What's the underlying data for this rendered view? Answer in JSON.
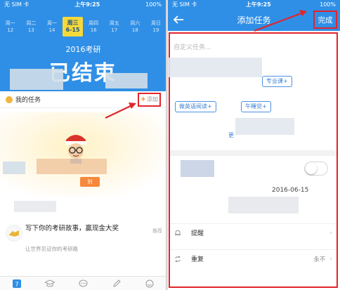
{
  "left": {
    "status": {
      "carrier": "无 SIM 卡",
      "time": "上午9:25",
      "battery": "100%"
    },
    "calendar": {
      "days": [
        {
          "label": "周一",
          "date": "12"
        },
        {
          "label": "周二",
          "date": "13"
        },
        {
          "label": "周一",
          "date": "14"
        },
        {
          "label": "周三",
          "date": "6-15",
          "selected": true
        },
        {
          "label": "周四",
          "date": "16"
        },
        {
          "label": "周五",
          "date": "17"
        },
        {
          "label": "周六",
          "date": "18"
        },
        {
          "label": "周日",
          "date": "19"
        }
      ],
      "year_title": "2016考研",
      "status_big": "已结束"
    },
    "tasks": {
      "title": "我的任务",
      "add_label": "添加"
    },
    "promo_tag": "别",
    "story": {
      "title": "写下你的考研故事，赢现金大奖",
      "subtitle": "让世界见证你的考研路",
      "more": "推荐"
    },
    "tabs": [
      "calendar-icon",
      "graduation-cap-icon",
      "chat-icon",
      "pencil-icon",
      "face-icon"
    ]
  },
  "right": {
    "status": {
      "carrier": "无 SIM 卡",
      "time": "上午9:25",
      "battery": "100%"
    },
    "nav": {
      "title": "添加任务",
      "done_label": "完成"
    },
    "custom_placeholder": "自定义任务...",
    "chips": [
      {
        "label": "专业课+"
      },
      {
        "label": "做英语阅读+"
      },
      {
        "label": "午睡觉+"
      }
    ],
    "more_link": "更",
    "date_value": "2016-06-15",
    "rows": [
      {
        "label": "提醒",
        "value": ""
      },
      {
        "label": "重复",
        "value": "永不"
      }
    ]
  },
  "colors": {
    "brand_blue": "#2f8fe6",
    "highlight_red": "#e2242c",
    "selected_day": "#f5d93a",
    "accent_orange": "#f6883b"
  }
}
